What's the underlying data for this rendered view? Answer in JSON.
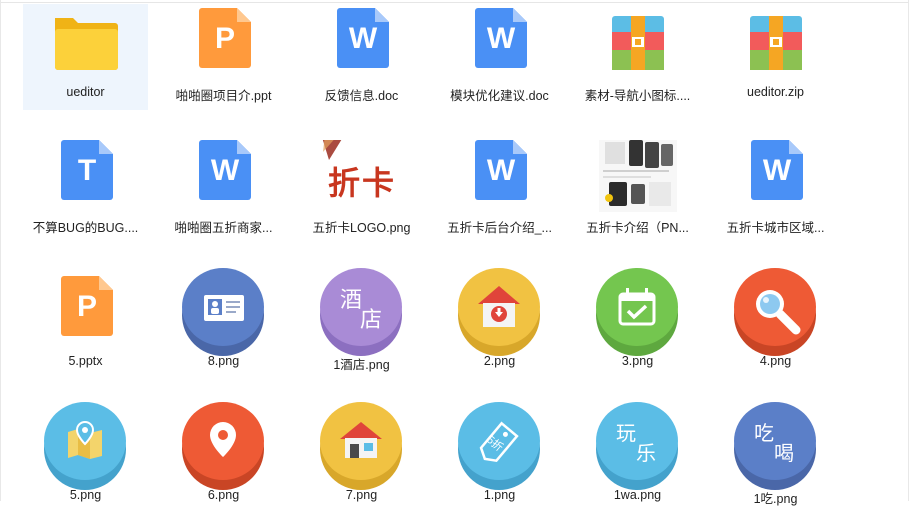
{
  "files": {
    "row1": [
      {
        "name": "ueditor",
        "icon": "folder-icon"
      },
      {
        "name": "啪啪圈项目介.ppt",
        "icon": "ppt-file-icon",
        "letter": "P"
      },
      {
        "name": "反馈信息.doc",
        "icon": "word-file-icon",
        "letter": "W"
      },
      {
        "name": "模块优化建议.doc",
        "icon": "word-file-icon",
        "letter": "W"
      },
      {
        "name": "素材-导航小图标....",
        "icon": "archive-file-icon"
      },
      {
        "name": "ueditor.zip",
        "icon": "archive-file-icon"
      }
    ],
    "row2": [
      {
        "name": "不算BUG的BUG....",
        "icon": "text-file-icon",
        "letter": "T"
      },
      {
        "name": "啪啪圈五折商家...",
        "icon": "word-file-icon",
        "letter": "W"
      },
      {
        "name": "五折卡LOGO.png",
        "icon": "image-thumbnail",
        "thumb_text": "折卡"
      },
      {
        "name": "五折卡后台介绍_...",
        "icon": "word-file-icon",
        "letter": "W"
      },
      {
        "name": "五折卡介绍（PN...",
        "icon": "image-thumbnail"
      },
      {
        "name": "五折卡城市区域...",
        "icon": "word-file-icon",
        "letter": "W"
      }
    ],
    "row3": [
      {
        "name": "5.pptx",
        "icon": "ppt-file-icon",
        "letter": "P"
      },
      {
        "name": "8.png",
        "icon": "id-card-icon"
      },
      {
        "name": "1酒店.png",
        "icon": "hotel-icon",
        "glyph1": "酒",
        "glyph2": "店"
      },
      {
        "name": "2.png",
        "icon": "home-download-icon"
      },
      {
        "name": "3.png",
        "icon": "calendar-check-icon"
      },
      {
        "name": "4.png",
        "icon": "magnifier-icon"
      }
    ],
    "row4": [
      {
        "name": "5.png",
        "icon": "map-pin-icon"
      },
      {
        "name": "6.png",
        "icon": "location-pin-icon"
      },
      {
        "name": "7.png",
        "icon": "house-icon"
      },
      {
        "name": "1.png",
        "icon": "discount-tag-icon",
        "glyph1": "5折"
      },
      {
        "name": "1wa.png",
        "icon": "play-icon",
        "glyph1": "玩",
        "glyph2": "乐"
      },
      {
        "name": "1吃.png",
        "icon": "eat-drink-icon",
        "glyph1": "吃",
        "glyph2": "喝"
      }
    ]
  },
  "colors": {
    "folder": "#f5c518",
    "ppt": "#ff9a3c",
    "word": "#4a90f5",
    "text": "#4a90f5",
    "blue_circle": "#5b7fc8",
    "purple_circle": "#a98bd6",
    "yellow_circle": "#f1c242",
    "green_circle": "#74c64f",
    "red_circle": "#ee5a35",
    "cyan_circle": "#5bbde6"
  }
}
